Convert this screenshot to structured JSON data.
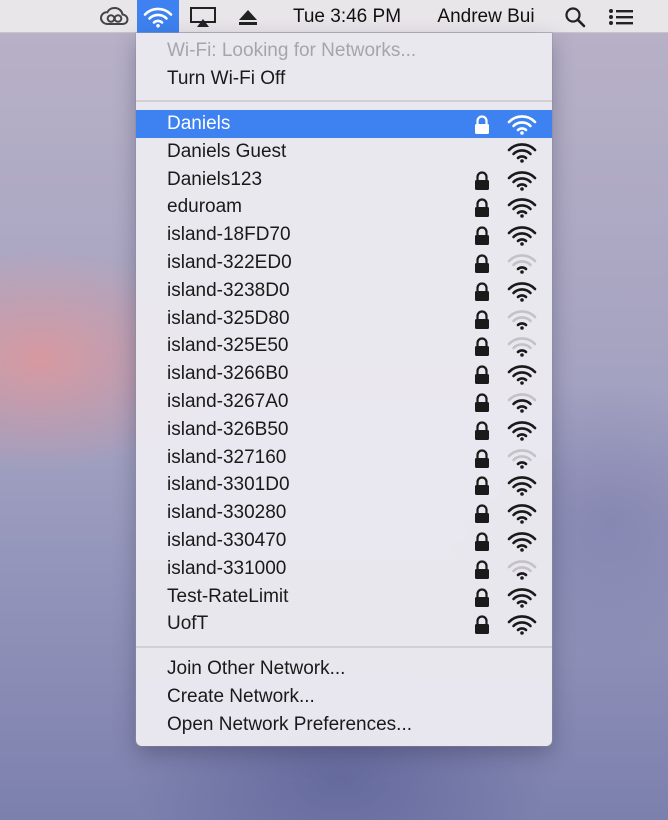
{
  "menubar": {
    "clock": "Tue 3:46 PM",
    "user": "Andrew Bui",
    "icons": [
      "creative-cloud-icon",
      "wifi-icon",
      "airplay-icon",
      "eject-icon",
      "spotlight-search-icon",
      "notification-center-icon"
    ]
  },
  "menu": {
    "status": "Wi-Fi: Looking for Networks...",
    "toggle": "Turn Wi-Fi Off",
    "networks": [
      {
        "name": "Daniels",
        "locked": true,
        "signal": "strong",
        "selected": true
      },
      {
        "name": "Daniels Guest",
        "locked": false,
        "signal": "strong"
      },
      {
        "name": "Daniels123",
        "locked": true,
        "signal": "strong"
      },
      {
        "name": "eduroam",
        "locked": true,
        "signal": "strong"
      },
      {
        "name": "island-18FD70",
        "locked": true,
        "signal": "strong"
      },
      {
        "name": "island-322ED0",
        "locked": true,
        "signal": "weak"
      },
      {
        "name": "island-3238D0",
        "locked": true,
        "signal": "strong"
      },
      {
        "name": "island-325D80",
        "locked": true,
        "signal": "weak"
      },
      {
        "name": "island-325E50",
        "locked": true,
        "signal": "weak"
      },
      {
        "name": "island-3266B0",
        "locked": true,
        "signal": "strong"
      },
      {
        "name": "island-3267A0",
        "locked": true,
        "signal": "medium"
      },
      {
        "name": "island-326B50",
        "locked": true,
        "signal": "strong"
      },
      {
        "name": "island-327160",
        "locked": true,
        "signal": "weak"
      },
      {
        "name": "island-3301D0",
        "locked": true,
        "signal": "strong"
      },
      {
        "name": "island-330280",
        "locked": true,
        "signal": "strong"
      },
      {
        "name": "island-330470",
        "locked": true,
        "signal": "strong"
      },
      {
        "name": "island-331000",
        "locked": true,
        "signal": "weak"
      },
      {
        "name": "Test-RateLimit",
        "locked": true,
        "signal": "strong"
      },
      {
        "name": "UofT",
        "locked": true,
        "signal": "strong"
      }
    ],
    "join_other": "Join Other Network...",
    "create": "Create Network...",
    "preferences": "Open Network Preferences..."
  },
  "colors": {
    "highlight": "#3d82f0",
    "menubar": "#e9e6ea"
  }
}
